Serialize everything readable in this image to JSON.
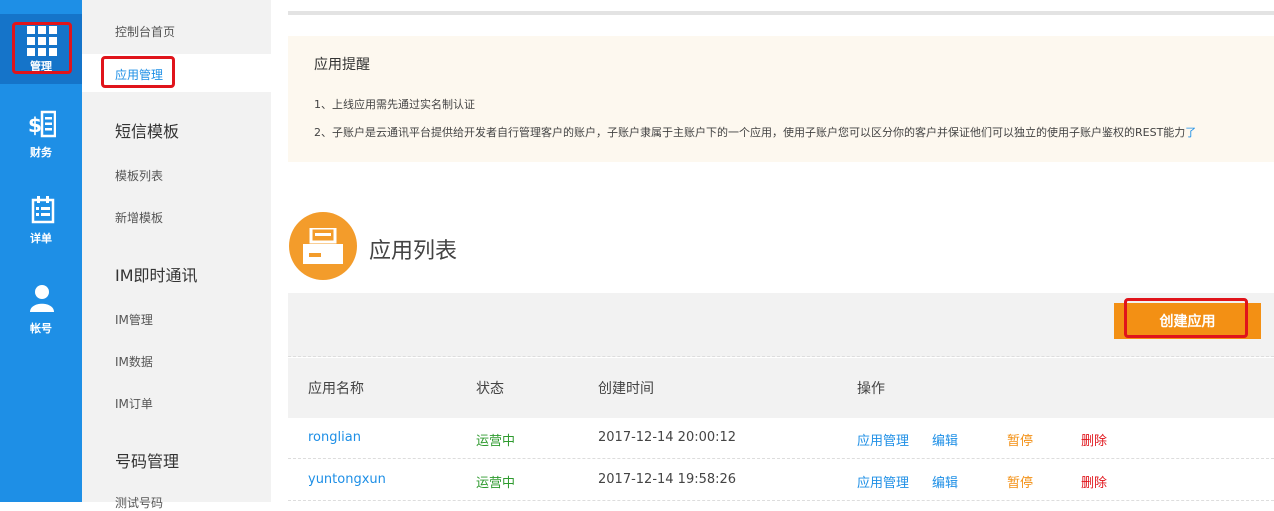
{
  "rail": {
    "items": [
      {
        "label": "管理",
        "icon": "grid-icon"
      },
      {
        "label": "财务",
        "icon": "finance-icon"
      },
      {
        "label": "详单",
        "icon": "calendar-icon"
      },
      {
        "label": "帐号",
        "icon": "user-icon"
      }
    ]
  },
  "subnav": {
    "console_home": "控制台首页",
    "app_manage": "应用管理",
    "sms_template": "短信模板",
    "template_list": "模板列表",
    "add_template": "新增模板",
    "im": "IM即时通讯",
    "im_manage": "IM管理",
    "im_data": "IM数据",
    "im_order": "IM订单",
    "number_manage": "号码管理",
    "test_number": "测试号码"
  },
  "notice": {
    "title": "应用提醒",
    "line1": "1、上线应用需先通过实名制认证",
    "line2": "2、子账户是云通讯平台提供给开发者自行管理客户的账户，子账户隶属于主账户下的一个应用，使用子账户您可以区分你的客户并保证他们可以独立的使用子账户鉴权的REST能力",
    "line2_more": "了"
  },
  "app_list": {
    "title": "应用列表",
    "create_button": "创建应用",
    "columns": [
      "应用名称",
      "状态",
      "创建时间",
      "操作"
    ],
    "rows": [
      {
        "name": "ronglian",
        "status": "运营中",
        "created": "2017-12-14 20:00:12",
        "actions": {
          "manage": "应用管理",
          "edit": "编辑",
          "pause": "暂停",
          "delete": "删除"
        }
      },
      {
        "name": "yuntongxun",
        "status": "运营中",
        "created": "2017-12-14 19:58:26",
        "actions": {
          "manage": "应用管理",
          "edit": "编辑",
          "pause": "暂停",
          "delete": "删除"
        }
      }
    ]
  },
  "colors": {
    "rail_blue": "#1e8fe6",
    "accent_orange": "#f39014",
    "status_green": "#2e9a2e",
    "delete_red": "#e0141b",
    "highlight_red": "#e0141b"
  }
}
